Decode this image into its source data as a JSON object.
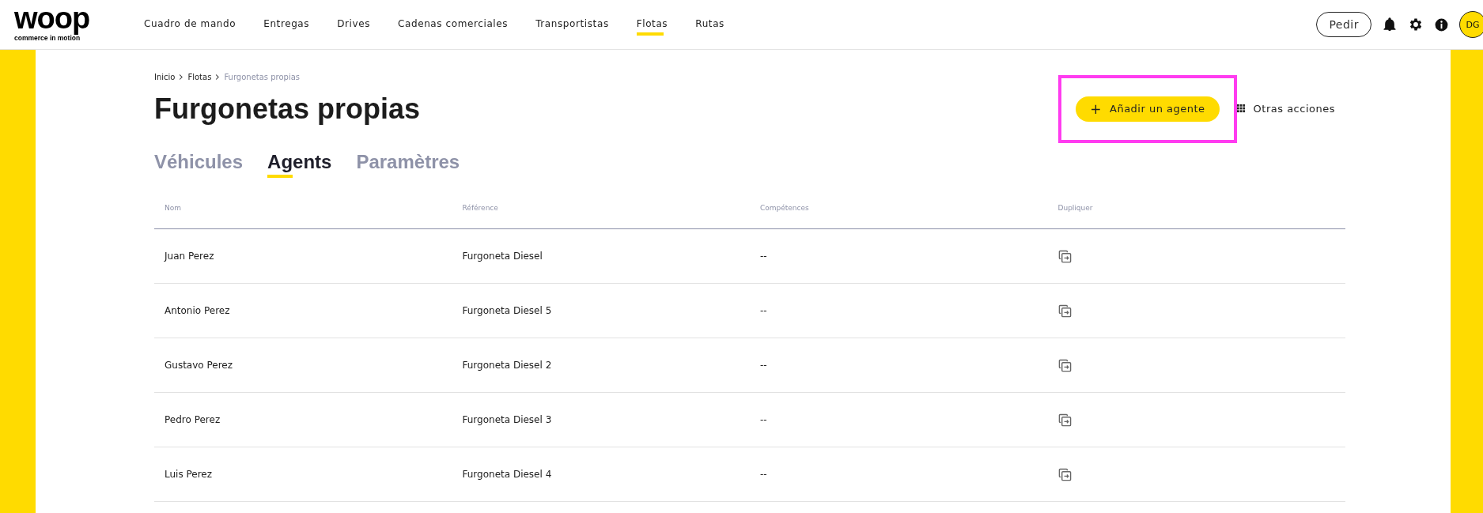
{
  "logo": {
    "wordmark": "woop",
    "tagline": "commerce in motion"
  },
  "nav": [
    {
      "label": "Cuadro de mando",
      "selected": false
    },
    {
      "label": "Entregas",
      "selected": false
    },
    {
      "label": "Drives",
      "selected": false
    },
    {
      "label": "Cadenas comerciales",
      "selected": false
    },
    {
      "label": "Transportistas",
      "selected": false
    },
    {
      "label": "Flotas",
      "selected": true
    },
    {
      "label": "Rutas",
      "selected": false
    }
  ],
  "header_actions": {
    "order_button": "Pedir",
    "avatar": "DG"
  },
  "breadcrumb": [
    {
      "label": "Inicio",
      "current": false
    },
    {
      "label": "Flotas",
      "current": false
    },
    {
      "label": "Furgonetas propias",
      "current": true
    }
  ],
  "title": "Furgonetas propias",
  "primary_action": {
    "icon": "+",
    "label": "Añadir un agente",
    "highlighted": true
  },
  "more_actions": "Otras acciones",
  "tabs": [
    {
      "label": "Véhicules",
      "selected": false
    },
    {
      "label": "Agents",
      "selected": true
    },
    {
      "label": "Paramètres",
      "selected": false
    }
  ],
  "table": {
    "columns": [
      "Nom",
      "Référence",
      "Compétences",
      "Dupliquer"
    ],
    "rows": [
      {
        "name": "Juan Perez",
        "reference": "Furgoneta Diesel",
        "skills": "--"
      },
      {
        "name": "Antonio Perez",
        "reference": "Furgoneta Diesel 5",
        "skills": "--"
      },
      {
        "name": "Gustavo Perez",
        "reference": "Furgoneta Diesel 2",
        "skills": "--"
      },
      {
        "name": "Pedro Perez",
        "reference": "Furgoneta Diesel 3",
        "skills": "--"
      },
      {
        "name": "Luis Perez",
        "reference": "Furgoneta Diesel 4",
        "skills": "--"
      }
    ]
  }
}
